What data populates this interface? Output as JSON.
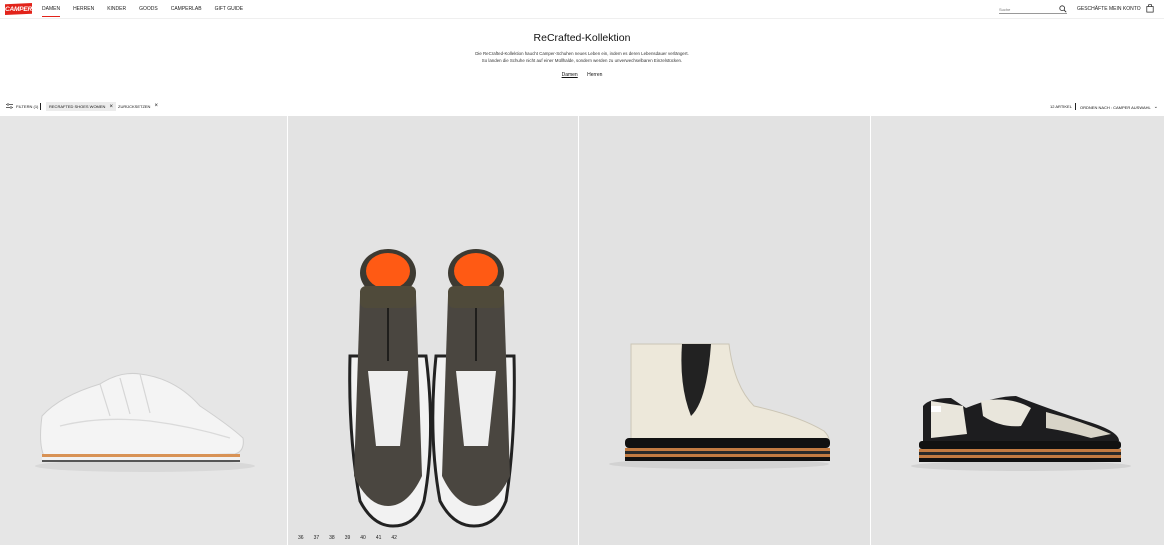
{
  "brand": {
    "logo_text": "CAMPER",
    "accent": "#e2231a"
  },
  "nav": {
    "items": [
      {
        "label": "DAMEN",
        "active": true
      },
      {
        "label": "HERREN"
      },
      {
        "label": "KINDER"
      },
      {
        "label": "GOODS"
      },
      {
        "label": "CAMPERLAB"
      },
      {
        "label": "GIFT GUIDE"
      }
    ]
  },
  "header": {
    "search_placeholder": "Suche",
    "stores_label": "GESCHÄFTE",
    "account_label": "MEIN KONTO"
  },
  "hero": {
    "title": "ReCrafted-Kollektion",
    "description_line1": "Die ReCrafted-Kollektion haucht Camper-Schuhen neues Leben ein, indem es deren Lebensdauer verlängert.",
    "description_line2": "So landen die Schuhe nicht auf einer Müllhalde, sondern werden zu unverwechselbaren Einzelstücken.",
    "links": [
      {
        "label": "Damen",
        "selected": true
      },
      {
        "label": "Herren",
        "selected": false
      }
    ]
  },
  "filters": {
    "filters_label": "FILTERN (1)",
    "active_chip": "RECRAFTED SHOES WOMEN",
    "reset_label": "ZURÜCKSETZEN",
    "count_label": "12 ARTIKEL",
    "sort_label": "ORDNEN NACH : CAMPER AUSWAHL"
  },
  "products": [
    {
      "image": "white-sneaker-side"
    },
    {
      "image": "black-white-zip-boots-top",
      "sizes": [
        "36",
        "37",
        "38",
        "39",
        "40",
        "41",
        "42"
      ]
    },
    {
      "image": "cream-chelsea-boot-side"
    },
    {
      "image": "black-cream-sneaker-side"
    }
  ]
}
